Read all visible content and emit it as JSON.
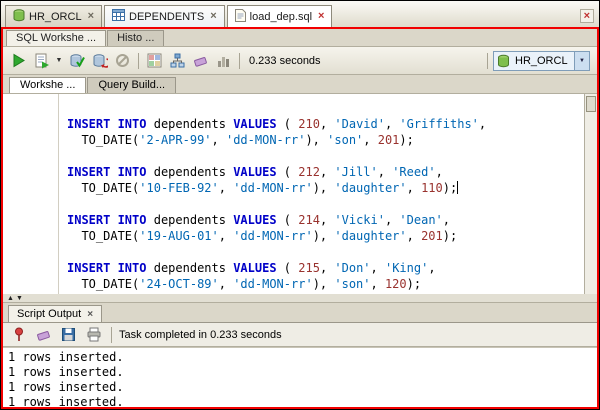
{
  "glyphs": {
    "close": "×",
    "dropdown": "▼",
    "up": "▲",
    "down": "▼"
  },
  "doc_tabs": [
    {
      "label": "HR_ORCL"
    },
    {
      "label": "DEPENDENTS"
    },
    {
      "label": "load_dep.sql"
    }
  ],
  "worksheet": {
    "tab_sql": "SQL Workshe ...",
    "tab_history": "Histo ...",
    "time": "0.233 seconds",
    "connection": "HR_ORCL",
    "subtab_worksheet": "Workshe ...",
    "subtab_query_builder": "Query Build..."
  },
  "editor": {
    "lines": [
      [
        [
          "k",
          "INSERT INTO"
        ],
        [
          "p",
          " "
        ],
        [
          "i",
          "dependents"
        ],
        [
          "p",
          " "
        ],
        [
          "k",
          "VALUES"
        ],
        [
          "p",
          " ( "
        ],
        [
          "n",
          "210"
        ],
        [
          "p",
          ", "
        ],
        [
          "s",
          "'David'"
        ],
        [
          "p",
          ", "
        ],
        [
          "s",
          "'Griffiths'"
        ],
        [
          "p",
          ","
        ]
      ],
      [
        [
          "p",
          "  "
        ],
        [
          "f",
          "TO_DATE"
        ],
        [
          "p",
          "("
        ],
        [
          "s",
          "'2-APR-99'"
        ],
        [
          "p",
          ", "
        ],
        [
          "s",
          "'dd-MON-rr'"
        ],
        [
          "p",
          "), "
        ],
        [
          "s",
          "'son'"
        ],
        [
          "p",
          ", "
        ],
        [
          "n",
          "201"
        ],
        [
          "p",
          ");"
        ]
      ],
      [],
      [
        [
          "k",
          "INSERT INTO"
        ],
        [
          "p",
          " "
        ],
        [
          "i",
          "dependents"
        ],
        [
          "p",
          " "
        ],
        [
          "k",
          "VALUES"
        ],
        [
          "p",
          " ( "
        ],
        [
          "n",
          "212"
        ],
        [
          "p",
          ", "
        ],
        [
          "s",
          "'Jill'"
        ],
        [
          "p",
          ", "
        ],
        [
          "s",
          "'Reed'"
        ],
        [
          "p",
          ","
        ]
      ],
      [
        [
          "p",
          "  "
        ],
        [
          "f",
          "TO_DATE"
        ],
        [
          "p",
          "("
        ],
        [
          "s",
          "'10-FEB-92'"
        ],
        [
          "p",
          ", "
        ],
        [
          "s",
          "'dd-MON-rr'"
        ],
        [
          "p",
          "), "
        ],
        [
          "s",
          "'daughter'"
        ],
        [
          "p",
          ", "
        ],
        [
          "n",
          "110"
        ],
        [
          "p",
          ");"
        ],
        [
          "c",
          ""
        ]
      ],
      [],
      [
        [
          "k",
          "INSERT INTO"
        ],
        [
          "p",
          " "
        ],
        [
          "i",
          "dependents"
        ],
        [
          "p",
          " "
        ],
        [
          "k",
          "VALUES"
        ],
        [
          "p",
          " ( "
        ],
        [
          "n",
          "214"
        ],
        [
          "p",
          ", "
        ],
        [
          "s",
          "'Vicki'"
        ],
        [
          "p",
          ", "
        ],
        [
          "s",
          "'Dean'"
        ],
        [
          "p",
          ","
        ]
      ],
      [
        [
          "p",
          "  "
        ],
        [
          "f",
          "TO_DATE"
        ],
        [
          "p",
          "("
        ],
        [
          "s",
          "'19-AUG-01'"
        ],
        [
          "p",
          ", "
        ],
        [
          "s",
          "'dd-MON-rr'"
        ],
        [
          "p",
          "), "
        ],
        [
          "s",
          "'daughter'"
        ],
        [
          "p",
          ", "
        ],
        [
          "n",
          "201"
        ],
        [
          "p",
          ");"
        ]
      ],
      [],
      [
        [
          "k",
          "INSERT INTO"
        ],
        [
          "p",
          " "
        ],
        [
          "i",
          "dependents"
        ],
        [
          "p",
          " "
        ],
        [
          "k",
          "VALUES"
        ],
        [
          "p",
          " ( "
        ],
        [
          "n",
          "215"
        ],
        [
          "p",
          ", "
        ],
        [
          "s",
          "'Don'"
        ],
        [
          "p",
          ", "
        ],
        [
          "s",
          "'King'"
        ],
        [
          "p",
          ","
        ]
      ],
      [
        [
          "p",
          "  "
        ],
        [
          "f",
          "TO_DATE"
        ],
        [
          "p",
          "("
        ],
        [
          "s",
          "'24-OCT-89'"
        ],
        [
          "p",
          ", "
        ],
        [
          "s",
          "'dd-MON-rr'"
        ],
        [
          "p",
          "), "
        ],
        [
          "s",
          "'son'"
        ],
        [
          "p",
          ", "
        ],
        [
          "n",
          "120"
        ],
        [
          "p",
          ");"
        ]
      ]
    ]
  },
  "output": {
    "tab": "Script Output",
    "status": "Task completed in 0.233 seconds",
    "lines": [
      "1 rows inserted.",
      "1 rows inserted.",
      "1 rows inserted.",
      "1 rows inserted."
    ]
  },
  "colors": {
    "focus_border": "#F20000",
    "keyword": "#0000C8",
    "string": "#0066B3",
    "number": "#99322E"
  }
}
